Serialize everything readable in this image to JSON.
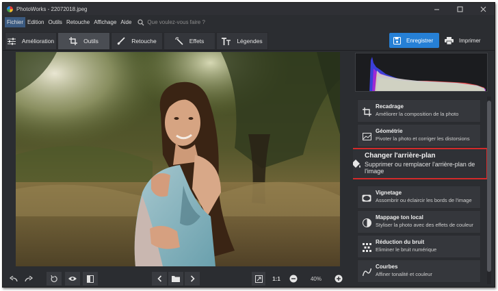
{
  "window": {
    "title": "PhotoWorks - 22072018.jpeg",
    "controls": [
      "minimize-icon",
      "maximize-icon",
      "close-icon"
    ]
  },
  "menu": {
    "items": [
      "Fichier",
      "Edition",
      "Outils",
      "Retouche",
      "Affichage",
      "Aide"
    ],
    "active": "Fichier",
    "search_placeholder": "Que voulez-vous faire ?"
  },
  "tabs": [
    {
      "label": "Amélioration",
      "icon": "sliders-icon"
    },
    {
      "label": "Outils",
      "icon": "crop-icon",
      "active": true
    },
    {
      "label": "Retouche",
      "icon": "brush-icon"
    },
    {
      "label": "Effets",
      "icon": "magic-wand-icon"
    },
    {
      "label": "Légendes",
      "icon": "text-icon"
    }
  ],
  "actions": {
    "save_label": "Enregistrer",
    "print_label": "Imprimer"
  },
  "bottom_bar": {
    "ratio_label": "1:1",
    "zoom_value": "40%"
  },
  "tools": [
    {
      "title": "Recadrage",
      "desc": "Améliorer la composition de la photo",
      "icon": "crop-icon"
    },
    {
      "title": "Géométrie",
      "desc": "Pivoter la photo et corriger les distorsions",
      "icon": "geometry-icon"
    },
    {
      "title": "Changer l'arrière-plan",
      "desc": "Supprimer ou remplacer l'arrière-plan de l'image",
      "icon": "paint-bucket-icon",
      "highlighted": true
    },
    {
      "title": "Vignetage",
      "desc": "Assombrir ou éclaircir les bords de l'image",
      "icon": "vignette-icon"
    },
    {
      "title": "Mappage ton local",
      "desc": "Styliser la photo avec des effets de couleur",
      "icon": "tone-mapping-icon"
    },
    {
      "title": "Réduction du bruit",
      "desc": "Eliminer le bruit numérique",
      "icon": "noise-reduction-icon"
    },
    {
      "title": "Courbes",
      "desc": "Affiner tonalité et couleur",
      "icon": "curves-icon"
    }
  ],
  "colors": {
    "accent": "#2680d6",
    "highlight_border": "#d42a2a",
    "background": "#2b2d31"
  }
}
